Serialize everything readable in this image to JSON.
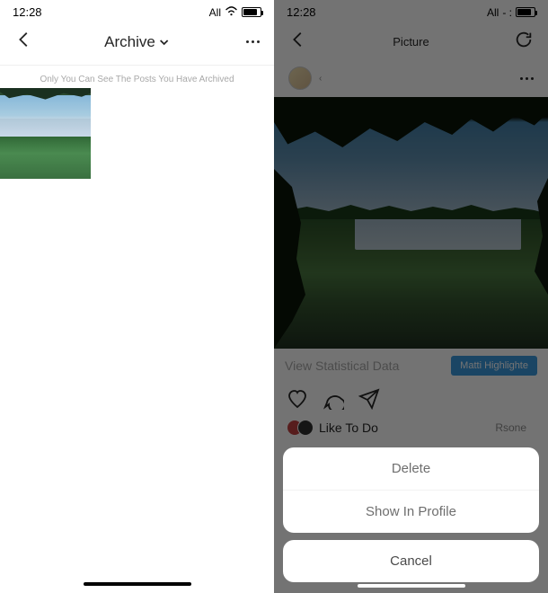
{
  "left": {
    "status": {
      "time": "12:28",
      "carrier": "All"
    },
    "header": {
      "title": "Archive"
    },
    "info_text": "Only You Can See The Posts You Have Archived"
  },
  "right": {
    "status": {
      "time": "12:28",
      "carrier": "All"
    },
    "header": {
      "title": "Picture"
    },
    "stat_link": "View Statistical Data",
    "stat_button": "Matti Highlighte",
    "like_text": "Like To Do",
    "user_hint": "Rsone",
    "sheet": {
      "delete": "Delete",
      "show": "Show In Profile",
      "cancel": "Cancel"
    }
  }
}
